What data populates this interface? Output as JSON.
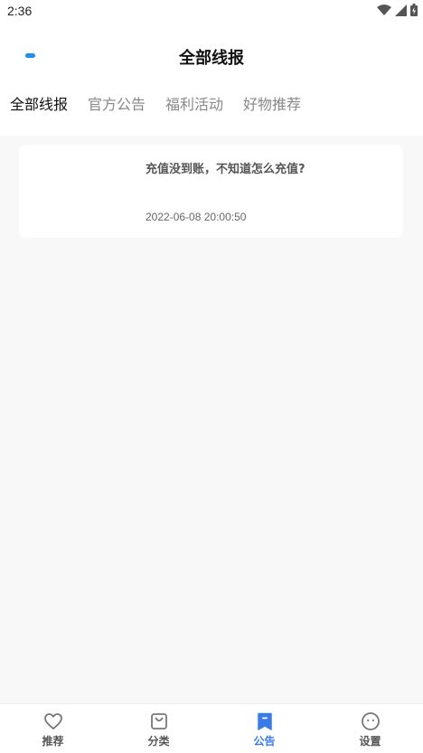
{
  "status_bar": {
    "time": "2:36"
  },
  "header": {
    "title": "全部线报"
  },
  "tabs": [
    {
      "label": "全部线报",
      "active": true
    },
    {
      "label": "官方公告",
      "active": false
    },
    {
      "label": "福利活动",
      "active": false
    },
    {
      "label": "好物推荐",
      "active": false
    }
  ],
  "posts": [
    {
      "title": "充值没到账，不知道怎么充值?",
      "time": "2022-06-08 20:00:50"
    }
  ],
  "bottom_nav": [
    {
      "label": "推荐",
      "icon": "heart-icon",
      "active": false
    },
    {
      "label": "分类",
      "icon": "bag-icon",
      "active": false
    },
    {
      "label": "公告",
      "icon": "bookmark-icon",
      "active": true
    },
    {
      "label": "设置",
      "icon": "face-icon",
      "active": false
    }
  ],
  "colors": {
    "accent": "#3a7be8",
    "tab_indicator": "#1e8ef2",
    "background": "#f8f8f8"
  }
}
